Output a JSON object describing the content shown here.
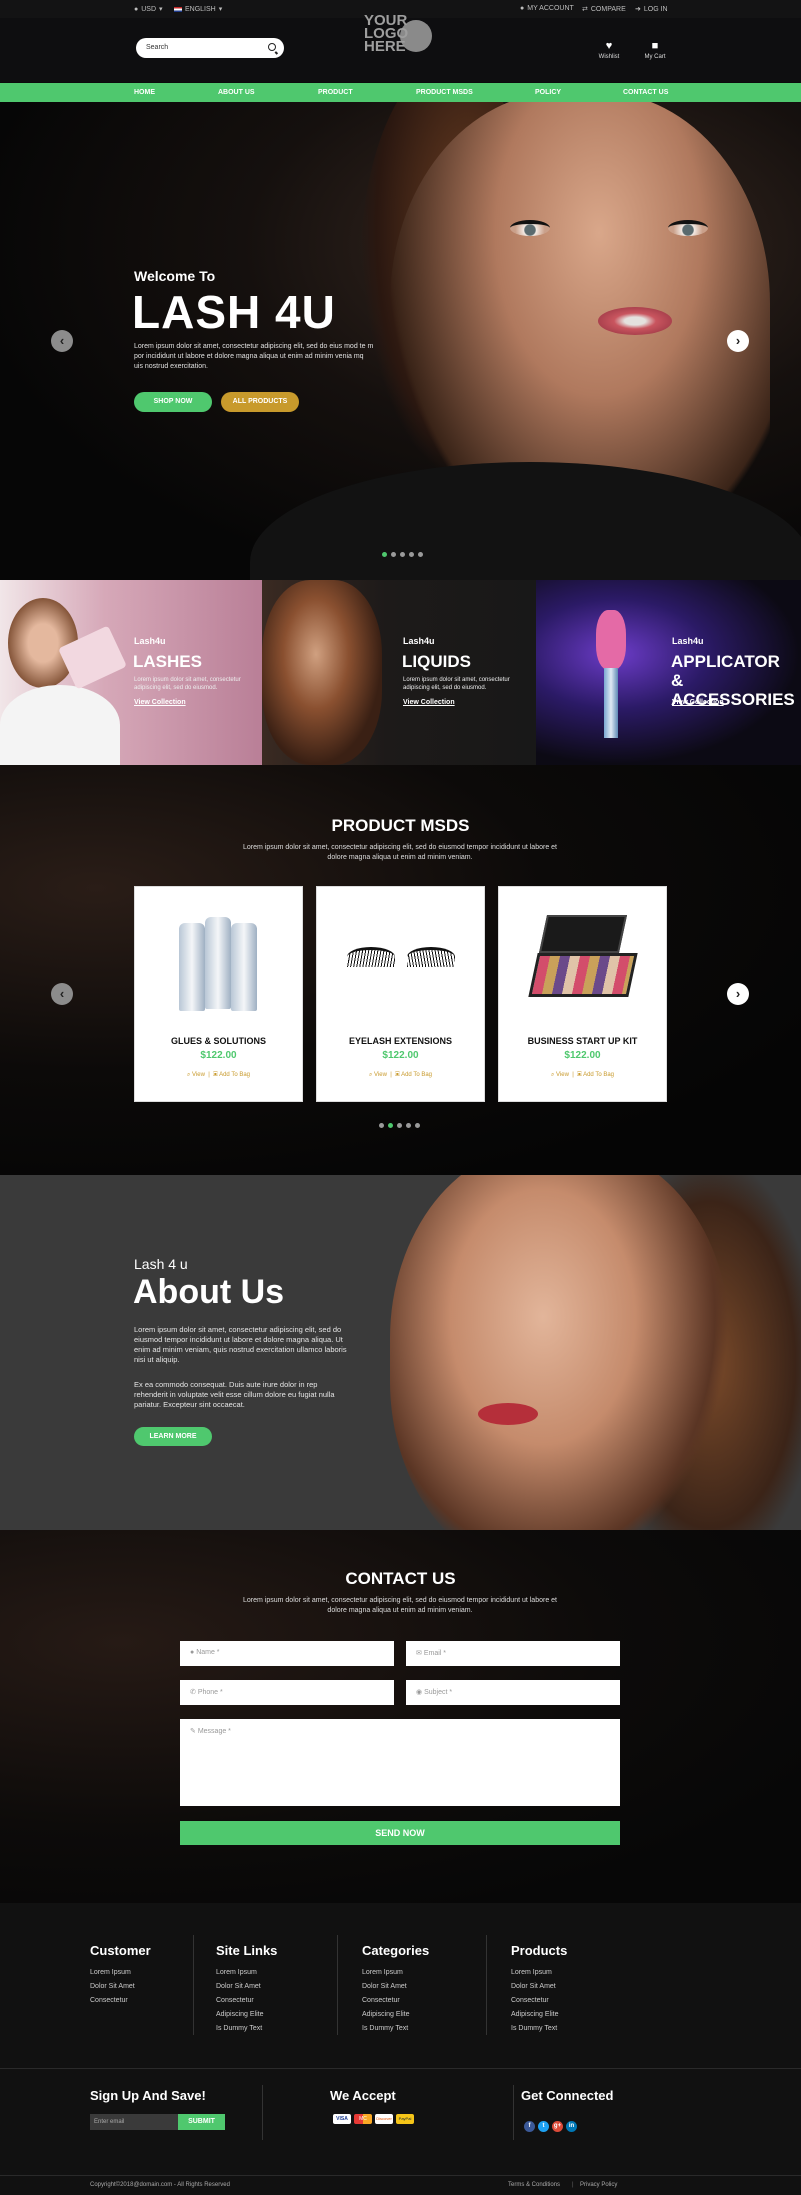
{
  "topbar": {
    "currency": "USD",
    "language": "ENGLISH",
    "account": "MY ACCOUNT",
    "compare": "COMPARE",
    "login": "LOG IN"
  },
  "header": {
    "search_placeholder": "Search",
    "logo_text": [
      "YOUR",
      "LOGO",
      "HERE"
    ],
    "wishlist": "Wishlist",
    "cart": "My Cart"
  },
  "nav": [
    "HOME",
    "ABOUT US",
    "PRODUCT",
    "PRODUCT MSDS",
    "POLICY",
    "CONTACT US"
  ],
  "hero": {
    "welcome": "Welcome To",
    "brand": "LASH 4U",
    "text": "Lorem ipsum dolor sit amet, consectetur adipiscing elit, sed do eius mod te m por incididunt ut labore et dolore magna aliqua ut enim ad minim venia mq uis nostrud exercitation.",
    "shop_now": "SHOP NOW",
    "all_products": "ALL PRODUCTS"
  },
  "categories": [
    {
      "brand": "Lash4u",
      "title": "LASHES",
      "desc": "Lorem ipsum dolor sit amet, consectetur adipiscing elit, sed do eiusmod.",
      "link": "View Collection"
    },
    {
      "brand": "Lash4u",
      "title": "LIQUIDS",
      "desc": "Lorem ipsum dolor sit amet, consectetur adipiscing elit, sed do eiusmod.",
      "link": "View Collection"
    },
    {
      "brand": "Lash4u",
      "title": "APPLICATOR & ACCESSORIES",
      "desc": "",
      "link": "View Collection"
    }
  ],
  "products_section": {
    "title": "PRODUCT MSDS",
    "subtitle": "Lorem ipsum dolor sit amet, consectetur adipiscing elit, sed do eiusmod tempor incididunt ut labore et dolore magna aliqua ut enim ad minim veniam.",
    "items": [
      {
        "name": "GLUES & SOLUTIONS",
        "price": "$122.00",
        "view": "View",
        "add": "Add To Bag"
      },
      {
        "name": "EYELASH EXTENSIONS",
        "price": "$122.00",
        "view": "View",
        "add": "Add To Bag"
      },
      {
        "name": "BUSINESS START UP KIT",
        "price": "$122.00",
        "view": "View",
        "add": "Add To Bag"
      }
    ]
  },
  "about": {
    "kicker": "Lash 4 u",
    "title": "About Us",
    "p1": "Lorem ipsum dolor sit amet, consectetur adipiscing elit, sed do eiusmod tempor incididunt ut labore et dolore magna aliqua. Ut enim ad minim veniam, quis nostrud exercitation ullamco laboris nisi ut aliquip.",
    "p2": "Ex ea commodo consequat. Duis aute irure dolor in rep rehenderit in voluptate velit esse cillum dolore eu fugiat nulla pariatur. Excepteur sint occaecat.",
    "button": "LEARN MORE"
  },
  "contact": {
    "title": "CONTACT US",
    "subtitle": "Lorem ipsum dolor sit amet, consectetur adipiscing elit, sed do eiusmod tempor incididunt ut labore et dolore magna aliqua ut enim ad minim veniam.",
    "name": "Name *",
    "email": "Email *",
    "phone": "Phone *",
    "subject": "Subject *",
    "message": "Message *",
    "send": "SEND NOW"
  },
  "footer": {
    "columns": [
      {
        "title": "Customer",
        "links": [
          "Lorem Ipsum",
          "Dolor Sit Amet",
          "Consectetur"
        ]
      },
      {
        "title": "Site Links",
        "links": [
          "Lorem Ipsum",
          "Dolor Sit Amet",
          "Consectetur",
          "Adipiscing Elite",
          "Is Dummy Text"
        ]
      },
      {
        "title": "Categories",
        "links": [
          "Lorem Ipsum",
          "Dolor Sit Amet",
          "Consectetur",
          "Adipiscing Elite",
          "Is Dummy Text"
        ]
      },
      {
        "title": "Products",
        "links": [
          "Lorem Ipsum",
          "Dolor Sit Amet",
          "Consectetur",
          "Adipiscing Elite",
          "Is Dummy Text"
        ]
      }
    ],
    "signup_title": "Sign Up And Save!",
    "email_placeholder": "Enter email",
    "submit": "SUBMIT",
    "accept_title": "We Accept",
    "payments": [
      "VISA",
      "MC",
      "Discover",
      "PayPal"
    ],
    "connect_title": "Get Connected",
    "social": [
      "f",
      "t",
      "g+",
      "in"
    ],
    "copyright": "Copyright©2018@domain.com - All Rights Reserved",
    "terms": "Terms & Conditions",
    "privacy": "Privacy Policy"
  },
  "colors": {
    "accent": "#4fc86e",
    "gold": "#c89a2c"
  }
}
